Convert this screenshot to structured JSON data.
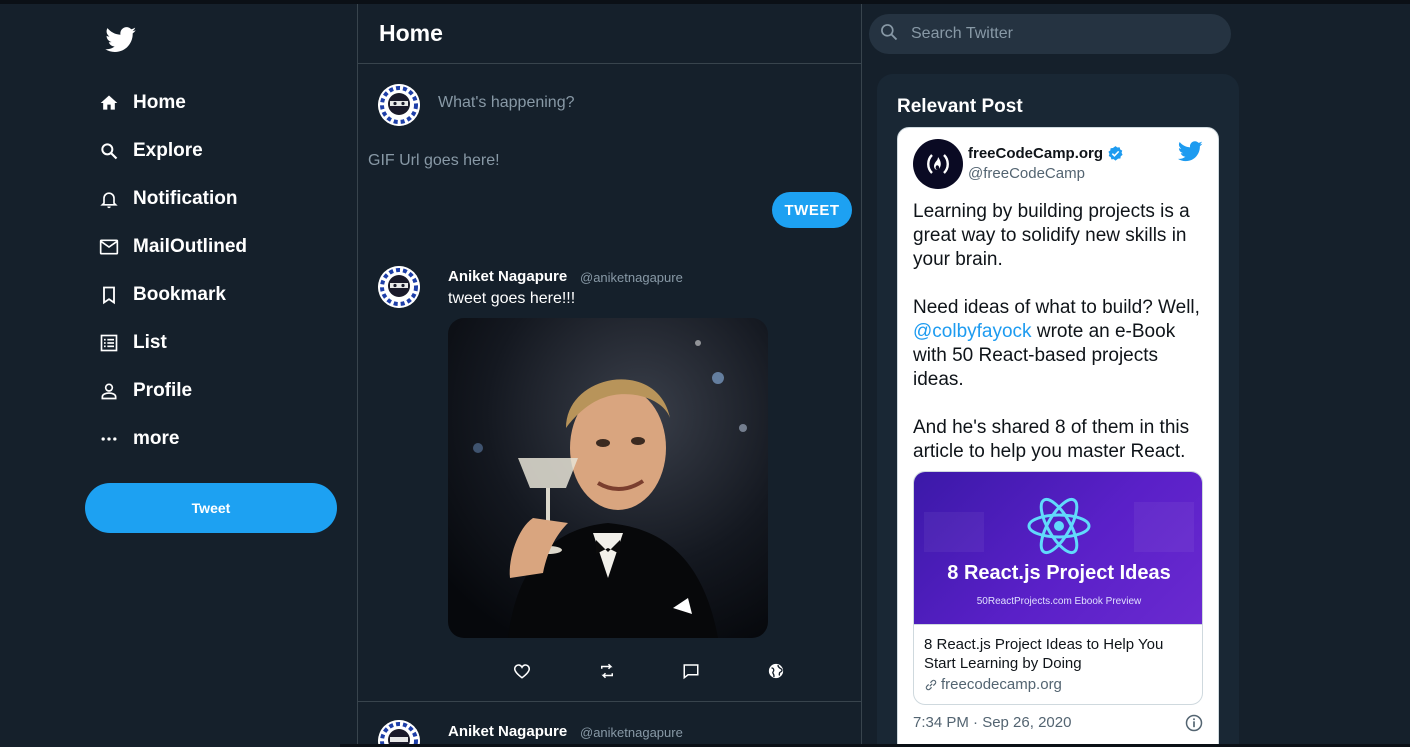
{
  "colors": {
    "background": "#15202b",
    "accent": "#1da1f2",
    "panel": "#192734",
    "border": "#38444d",
    "muted": "#8899a6"
  },
  "sidebar": {
    "logo_icon": "twitter-bird-icon",
    "items": [
      {
        "label": "Home",
        "icon": "home-icon"
      },
      {
        "label": "Explore",
        "icon": "search-icon"
      },
      {
        "label": "Notification",
        "icon": "bell-icon"
      },
      {
        "label": "MailOutlined",
        "icon": "mail-icon"
      },
      {
        "label": "Bookmark",
        "icon": "bookmark-icon"
      },
      {
        "label": "List",
        "icon": "list-icon"
      },
      {
        "label": "Profile",
        "icon": "person-icon"
      },
      {
        "label": "more",
        "icon": "more-icon"
      }
    ],
    "tweet_button": "Tweet"
  },
  "feed": {
    "title": "Home",
    "compose": {
      "placeholder": "What's happening?",
      "gif_placeholder": "GIF Url goes here!",
      "tweet_button": "TWEET"
    },
    "posts": [
      {
        "name": "Aniket Nagapure",
        "handle": "@aniketnagapure",
        "text": "tweet goes here!!!",
        "image": "gif-image",
        "actions": [
          "heart-icon",
          "retweet-icon",
          "comment-icon",
          "globe-icon"
        ]
      },
      {
        "name": "Aniket Nagapure",
        "handle": "@aniketnagapure"
      }
    ]
  },
  "search": {
    "placeholder": "Search Twitter"
  },
  "widget": {
    "title": "Relevant Post",
    "embed": {
      "name": "freeCodeCamp.org",
      "handle": "@freeCodeCamp",
      "paragraph1": "Learning by building projects is a great way to solidify new skills in your brain.",
      "paragraph2_before": "Need ideas of what to build? Well, ",
      "mention": "@colbyfayock",
      "paragraph2_after": " wrote an e-Book with 50 React-based projects ideas.",
      "paragraph3": "And he's shared 8 of them in this article to help you master React.",
      "link_image_title": "8 React.js Project Ideas",
      "link_image_subtitle": "50ReactProjects.com Ebook Preview",
      "link_title": "8 React.js Project Ideas to Help You Start Learning by Doing",
      "link_domain": "freecodecamp.org",
      "timestamp": "7:34 PM · Sep 26, 2020"
    }
  }
}
